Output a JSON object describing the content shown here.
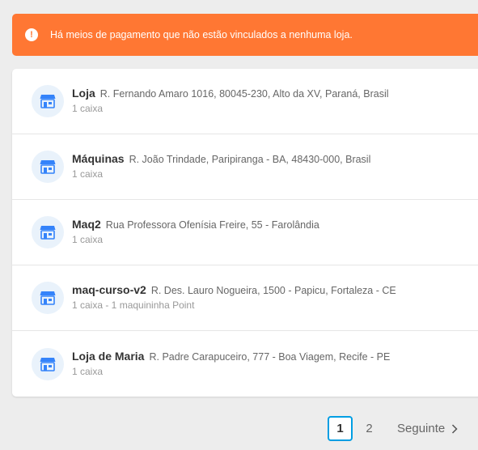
{
  "alert": {
    "icon": "exclamation-icon",
    "text": "Há meios de pagamento que não estão vinculados a nenhuma loja.",
    "color": "#ff7733"
  },
  "stores": [
    {
      "name": "Loja",
      "address": "R. Fernando Amaro 1016, 80045-230, Alto da XV, Paraná, Brasil",
      "detail": "1 caixa"
    },
    {
      "name": "Máquinas",
      "address": "R. João Trindade, Paripiranga - BA, 48430-000, Brasil",
      "detail": "1 caixa"
    },
    {
      "name": "Maq2",
      "address": "Rua Professora Ofenísia Freire, 55 - Farolândia",
      "detail": "1 caixa"
    },
    {
      "name": "maq-curso-v2",
      "address": "R. Des. Lauro Nogueira, 1500 - Papicu, Fortaleza - CE",
      "detail": "1 caixa - 1 maquininha Point"
    },
    {
      "name": "Loja de Maria",
      "address": "R. Padre Carapuceiro, 777 - Boa Viagem, Recife - PE",
      "detail": "1 caixa"
    }
  ],
  "pagination": {
    "current": "1",
    "page2": "2",
    "next_label": "Seguinte",
    "accent": "#009ee3"
  }
}
